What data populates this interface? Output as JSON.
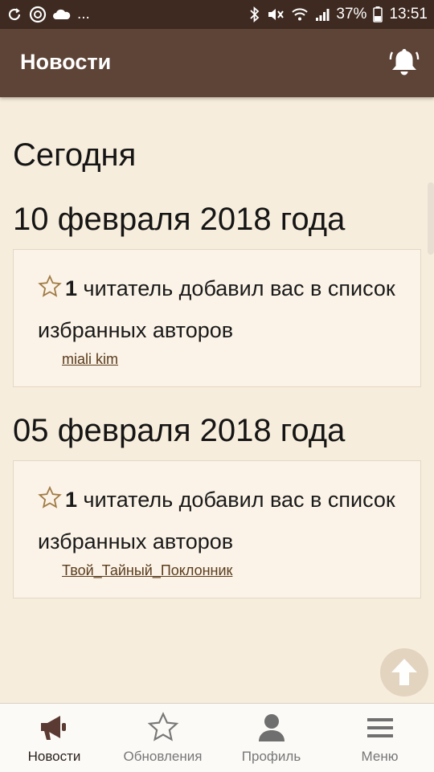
{
  "status_bar": {
    "left_icons": [
      "sync-icon",
      "app-icon",
      "cloud-icon"
    ],
    "more": "...",
    "battery": "37%",
    "time": "13:51"
  },
  "app_bar": {
    "title": "Новости",
    "bell_icon": "bell-icon"
  },
  "content": {
    "today_label": "Сегодня",
    "groups": [
      {
        "date": "10 февраля 2018 года",
        "count": "1",
        "text": " читатель добавил вас в список избранных авторов",
        "user": "miali kim"
      },
      {
        "date": "05 февраля 2018 года",
        "count": "1",
        "text": " читатель добавил вас в список избранных авторов",
        "user": "Твой_Тайный_Поклонник"
      }
    ]
  },
  "bottom_nav": {
    "items": [
      {
        "label": "Новости",
        "icon": "megaphone-icon",
        "active": true
      },
      {
        "label": "Обновления",
        "icon": "star-icon",
        "active": false
      },
      {
        "label": "Профиль",
        "icon": "person-icon",
        "active": false
      },
      {
        "label": "Меню",
        "icon": "menu-icon",
        "active": false
      }
    ]
  },
  "colors": {
    "status_bar": "#3e2a20",
    "app_bar": "#5e4437",
    "background": "#f7eddc",
    "card": "#fbf3e7",
    "link": "#5a3b1c",
    "star": "#a07a45"
  }
}
